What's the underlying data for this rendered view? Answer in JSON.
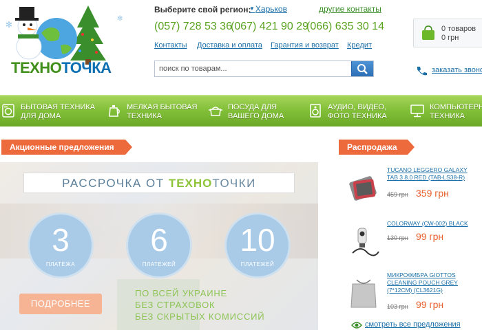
{
  "header": {
    "logo": {
      "part1": "ТЕХНО",
      "part2": "ТОЧКА"
    },
    "region_label": "Выберите свой регион:",
    "region_value": "Харьков",
    "other_contacts": "другие контакты",
    "phones": [
      "(057) 728 53 36",
      "(067) 421 90 29",
      "(066) 635 30 14"
    ],
    "links": [
      "Контакты",
      "Доставка и оплата",
      "Гарантия и возврат",
      "Кредит"
    ],
    "search_placeholder": "поиск по товарам...",
    "cart": {
      "items": "0 товаров",
      "sum": "0 грн"
    },
    "callback": "заказать звонок"
  },
  "nav": {
    "items": [
      {
        "label": "БЫТОВАЯ ТЕХНИКА\nДЛЯ ДОМА",
        "icon": "washing-machine-icon"
      },
      {
        "label": "МЕЛКАЯ БЫТОВАЯ\nТЕХНИКА",
        "icon": "kettle-icon"
      },
      {
        "label": "ПОСУДА ДЛЯ\nВАШЕГО ДОМА",
        "icon": "pot-icon"
      },
      {
        "label": "АУДИО, ВИДЕО,\nФОТО ТЕХНИКА",
        "icon": "speaker-icon"
      },
      {
        "label": "КОМПЬЮТЕРНАЯ\nТЕХНИКА",
        "icon": "monitor-icon"
      }
    ]
  },
  "promo": {
    "heading": "Акционные предложения",
    "banner": {
      "title_part1": "РАССРОЧКА ОТ ",
      "title_part2": "ТЕХНО",
      "title_part3": "ТОЧКИ",
      "circles": [
        {
          "num": "3",
          "label": "ПЛАТЕЖА"
        },
        {
          "num": "6",
          "label": "ПЛАТЕЖЕЙ"
        },
        {
          "num": "10",
          "label": "ПЛАТЕЖЕЙ"
        }
      ],
      "button": "ПОДРОБНЕЕ",
      "lines": [
        "ПО ВСЕЙ УКРАИНЕ",
        "БЕЗ СТРАХОВОК",
        "БЕЗ СКРЫТЫХ КОМИССИЙ"
      ]
    }
  },
  "sale": {
    "heading": "Распродажа",
    "items": [
      {
        "name": "TUCANO LEGGERO GALAXY TAB 3 8.0 RED (TAB-LS38-R)",
        "old_price": "459 грн",
        "new_price": "359 грн"
      },
      {
        "name": "COLORWAY (CW-002) BLACK",
        "old_price": "130 грн",
        "new_price": "99 грн"
      },
      {
        "name": "МИКРОФИБРА GIOTTOS CLEANING POUCH GREY (7*12CM) (CL3621G)",
        "old_price": "103 грн",
        "new_price": "99 грн"
      }
    ],
    "see_all": "смотреть все предложения"
  },
  "colors": {
    "green": "#84c03a",
    "orange": "#ec6a3c",
    "link": "#1b6fa8",
    "price": "#e8612d"
  }
}
